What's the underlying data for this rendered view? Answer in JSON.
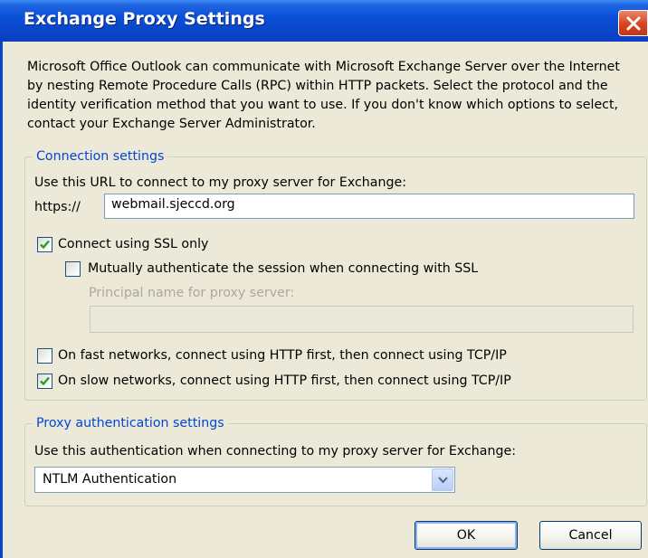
{
  "window": {
    "title": "Exchange Proxy Settings"
  },
  "intro_text": "Microsoft Office Outlook can communicate with Microsoft Exchange Server over the Internet by nesting Remote Procedure Calls (RPC) within HTTP packets.  Select the protocol and the identity verification method that you want to use.  If you don't know which options to select, contact your Exchange Server Administrator.",
  "connection": {
    "legend": "Connection settings",
    "url_label": "Use this URL to connect to my proxy server for Exchange:",
    "url_prefix": "https://",
    "url_value": "webmail.sjeccd.org",
    "ssl_label": "Connect using SSL only",
    "ssl_checked": true,
    "mutual_label": "Mutually authenticate the session when connecting with SSL",
    "mutual_checked": false,
    "principal_label": "Principal name for proxy server:",
    "principal_value": "",
    "fast_label": "On fast networks, connect using HTTP first, then connect using TCP/IP",
    "fast_checked": false,
    "slow_label": "On slow networks, connect using HTTP first, then connect using TCP/IP",
    "slow_checked": true
  },
  "proxy_auth": {
    "legend": "Proxy authentication settings",
    "auth_label": "Use this authentication when connecting to my proxy server for Exchange:",
    "selected": "NTLM Authentication"
  },
  "buttons": {
    "ok": "OK",
    "cancel": "Cancel"
  },
  "icons": {
    "close": "close-icon",
    "check": "checkmark-icon",
    "dropdown": "chevron-down-icon"
  },
  "colors": {
    "titlebar": "#0a46cc",
    "close": "#d6441f",
    "legend": "#0046d5",
    "background": "#ece9d8",
    "check": "#21a121"
  }
}
